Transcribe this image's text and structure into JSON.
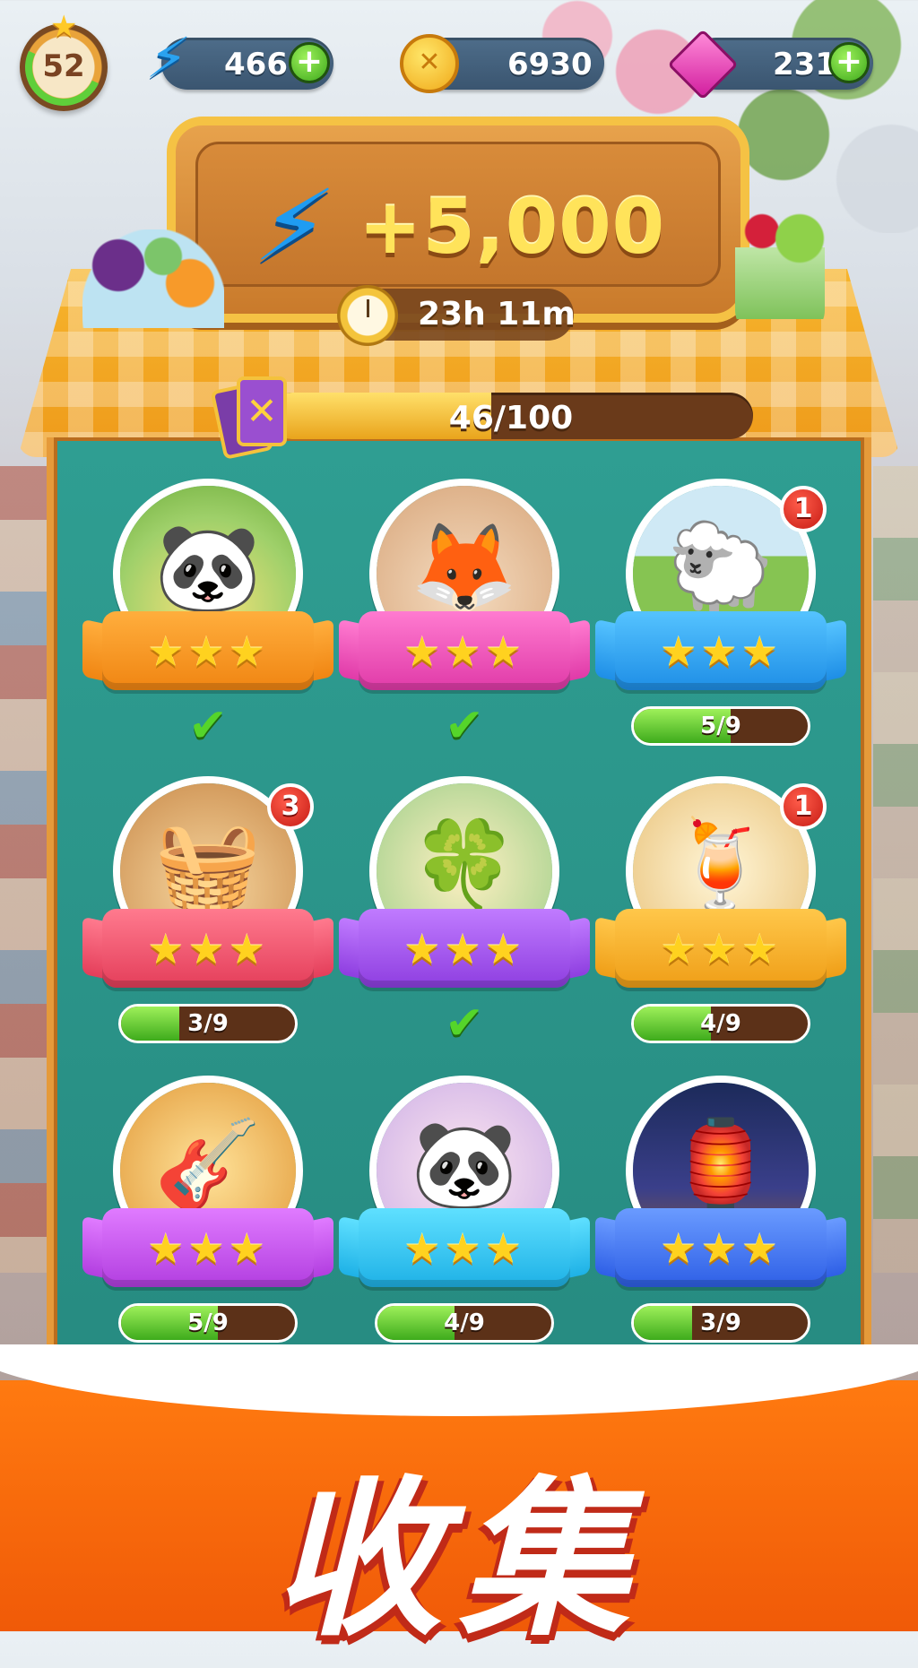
{
  "header": {
    "level": "52",
    "energy": {
      "value": "466",
      "icon": "lightning-bolt-icon"
    },
    "coins": {
      "value": "6930",
      "icon": "coin-fork-spoon-icon"
    },
    "gems": {
      "value": "231",
      "icon": "pink-gem-icon"
    },
    "plus_label": "+"
  },
  "event": {
    "reward": "+5,000",
    "reward_icon": "lightning-bolt-icon",
    "timer": "23h 11m",
    "progress_text": "46/100",
    "progress_fraction": 0.46
  },
  "albums": [
    {
      "id": "red-panda-flowers",
      "color": "orange",
      "scene": "🐼",
      "stars": "★★★",
      "status": "complete",
      "badge": null
    },
    {
      "id": "red-panda-painting",
      "color": "pink",
      "scene": "🦊",
      "stars": "★★★",
      "status": "complete",
      "badge": null
    },
    {
      "id": "lambs-meadow",
      "color": "blue",
      "scene": "🐑",
      "stars": "★★★",
      "status": "progress",
      "progress": "5/9",
      "fraction": 0.5556,
      "badge": "1"
    },
    {
      "id": "picnic-basket",
      "color": "red",
      "scene": "🧺",
      "stars": "★★★",
      "status": "progress",
      "progress": "3/9",
      "fraction": 0.3333,
      "badge": "3"
    },
    {
      "id": "red-panda-leprechaun",
      "color": "purple",
      "scene": "🍀",
      "stars": "★★★",
      "status": "complete",
      "badge": null
    },
    {
      "id": "mojito-glass",
      "color": "gold",
      "scene": "🍹",
      "stars": "★★★",
      "status": "progress",
      "progress": "4/9",
      "fraction": 0.4444,
      "badge": "1"
    },
    {
      "id": "girl-guitar",
      "color": "violet",
      "scene": "🎸",
      "stars": "★★★",
      "status": "progress",
      "progress": "5/9",
      "fraction": 0.5556,
      "badge": null
    },
    {
      "id": "panda-candy",
      "color": "cyan",
      "scene": "🐼",
      "stars": "★★★",
      "status": "progress",
      "progress": "4/9",
      "fraction": 0.4444,
      "badge": null
    },
    {
      "id": "night-market",
      "color": "royal",
      "scene": "🏮",
      "stars": "★★★",
      "status": "progress",
      "progress": "3/9",
      "fraction": 0.3333,
      "badge": null
    }
  ],
  "checkmark": "✔",
  "banner": {
    "title": "收集"
  }
}
